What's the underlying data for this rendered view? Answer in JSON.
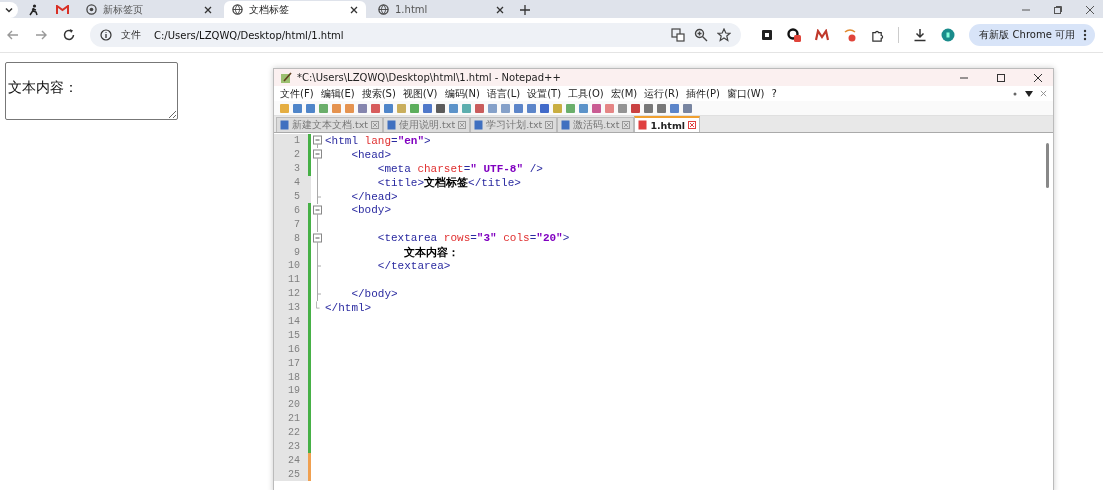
{
  "browser": {
    "tabs": [
      {
        "kind": "pinned",
        "selected": false
      },
      {
        "kind": "pinned",
        "selected": false
      },
      {
        "kind": "normal",
        "label": "新标签页",
        "selected": false
      },
      {
        "kind": "normal",
        "label": "文档标签",
        "selected": true
      },
      {
        "kind": "normal",
        "label": "1.html",
        "selected": false
      }
    ],
    "address": {
      "scheme": "文件",
      "url": "C:/Users/LZQWQ/Desktop/html/1.html"
    },
    "update_button": "有新版 Chrome 可用"
  },
  "page": {
    "textarea_value": "文本内容："
  },
  "notepad": {
    "title": "*C:\\Users\\LZQWQ\\Desktop\\html\\1.html - Notepad++",
    "menu": [
      "文件(F)",
      "编辑(E)",
      "搜索(S)",
      "视图(V)",
      "编码(N)",
      "语言(L)",
      "设置(T)",
      "工具(O)",
      "宏(M)",
      "运行(R)",
      "插件(P)",
      "窗口(W)",
      "?"
    ],
    "tabs": [
      {
        "label": "新建文本文档.txt",
        "selected": false
      },
      {
        "label": "使用说明.txt",
        "selected": false
      },
      {
        "label": "学习计划.txt",
        "selected": false
      },
      {
        "label": "激活码.txt",
        "selected": false
      },
      {
        "label": "1.html",
        "selected": true
      }
    ],
    "lines": [
      {
        "no": "1",
        "kind": "open",
        "changed": true,
        "saved": true,
        "code": [
          {
            "kind": "tag",
            "text": "<html "
          },
          {
            "kind": "attr",
            "text": "lang"
          },
          {
            "kind": "tag",
            "text": "="
          },
          {
            "kind": "value",
            "text": "\"en\""
          },
          {
            "kind": "tag",
            "text": ">"
          }
        ]
      },
      {
        "no": "2",
        "kind": "open",
        "changed": true,
        "saved": true,
        "code": [
          {
            "kind": "tag",
            "text": "    <head>"
          }
        ]
      },
      {
        "no": "3",
        "kind": "inner",
        "changed": true,
        "saved": true,
        "code": [
          {
            "kind": "tag",
            "text": "        <meta "
          },
          {
            "kind": "attr",
            "text": "charset"
          },
          {
            "kind": "tag",
            "text": "="
          },
          {
            "kind": "value",
            "text": "\" UTF-8\""
          },
          {
            "kind": "tag",
            "text": " />"
          }
        ]
      },
      {
        "no": "4",
        "kind": "inner",
        "changed": false,
        "code": [
          {
            "kind": "tag",
            "text": "        <title>"
          },
          {
            "kind": "text",
            "text": "文档标签"
          },
          {
            "kind": "tag",
            "text": "</title>"
          }
        ]
      },
      {
        "no": "5",
        "kind": "end",
        "changed": false,
        "code": [
          {
            "kind": "tag",
            "text": "    </head>"
          }
        ]
      },
      {
        "no": "6",
        "kind": "open",
        "changed": true,
        "saved": true,
        "code": [
          {
            "kind": "tag",
            "text": "    <body>"
          }
        ]
      },
      {
        "no": "7",
        "kind": "inner",
        "changed": true,
        "saved": true
      },
      {
        "no": "8",
        "kind": "open",
        "changed": true,
        "saved": true,
        "code": [
          {
            "kind": "tag",
            "text": "        <textarea "
          },
          {
            "kind": "attr",
            "text": "rows"
          },
          {
            "kind": "tag",
            "text": "="
          },
          {
            "kind": "value",
            "text": "\"3\""
          },
          {
            "kind": "attr",
            "text": " cols"
          },
          {
            "kind": "tag",
            "text": "="
          },
          {
            "kind": "value",
            "text": "\"20\""
          },
          {
            "kind": "tag",
            "text": ">"
          }
        ]
      },
      {
        "no": "9",
        "kind": "inner",
        "changed": true,
        "saved": true,
        "code": [
          {
            "kind": "text",
            "text": "            文本内容："
          }
        ]
      },
      {
        "no": "10",
        "kind": "end",
        "changed": true,
        "saved": true,
        "code": [
          {
            "kind": "tag",
            "text": "        </textarea>"
          }
        ]
      },
      {
        "no": "11",
        "kind": "inner",
        "changed": true,
        "saved": true
      },
      {
        "no": "12",
        "kind": "end",
        "changed": true,
        "saved": true,
        "code": [
          {
            "kind": "tag",
            "text": "    </body>"
          }
        ]
      },
      {
        "no": "13",
        "kind": "last",
        "changed": true,
        "saved": true,
        "code": [
          {
            "kind": "tag",
            "text": "</html>"
          }
        ]
      },
      {
        "no": "14",
        "kind": "plain",
        "changed": true,
        "saved": true
      },
      {
        "no": "15",
        "kind": "plain",
        "changed": true,
        "saved": true
      },
      {
        "no": "16",
        "kind": "plain",
        "changed": true,
        "saved": true
      },
      {
        "no": "17",
        "kind": "plain",
        "changed": true,
        "saved": true
      },
      {
        "no": "18",
        "kind": "plain",
        "changed": true,
        "saved": true
      },
      {
        "no": "19",
        "kind": "plain",
        "changed": true,
        "saved": true
      },
      {
        "no": "20",
        "kind": "plain",
        "changed": true,
        "saved": true
      },
      {
        "no": "21",
        "kind": "plain",
        "changed": true,
        "saved": true
      },
      {
        "no": "22",
        "kind": "plain",
        "changed": true,
        "saved": true
      },
      {
        "no": "23",
        "kind": "plain",
        "changed": true,
        "saved": true
      },
      {
        "no": "24",
        "kind": "plain",
        "changed": true,
        "saved": false
      },
      {
        "no": "25",
        "kind": "plain",
        "changed": true,
        "saved": false
      }
    ]
  }
}
